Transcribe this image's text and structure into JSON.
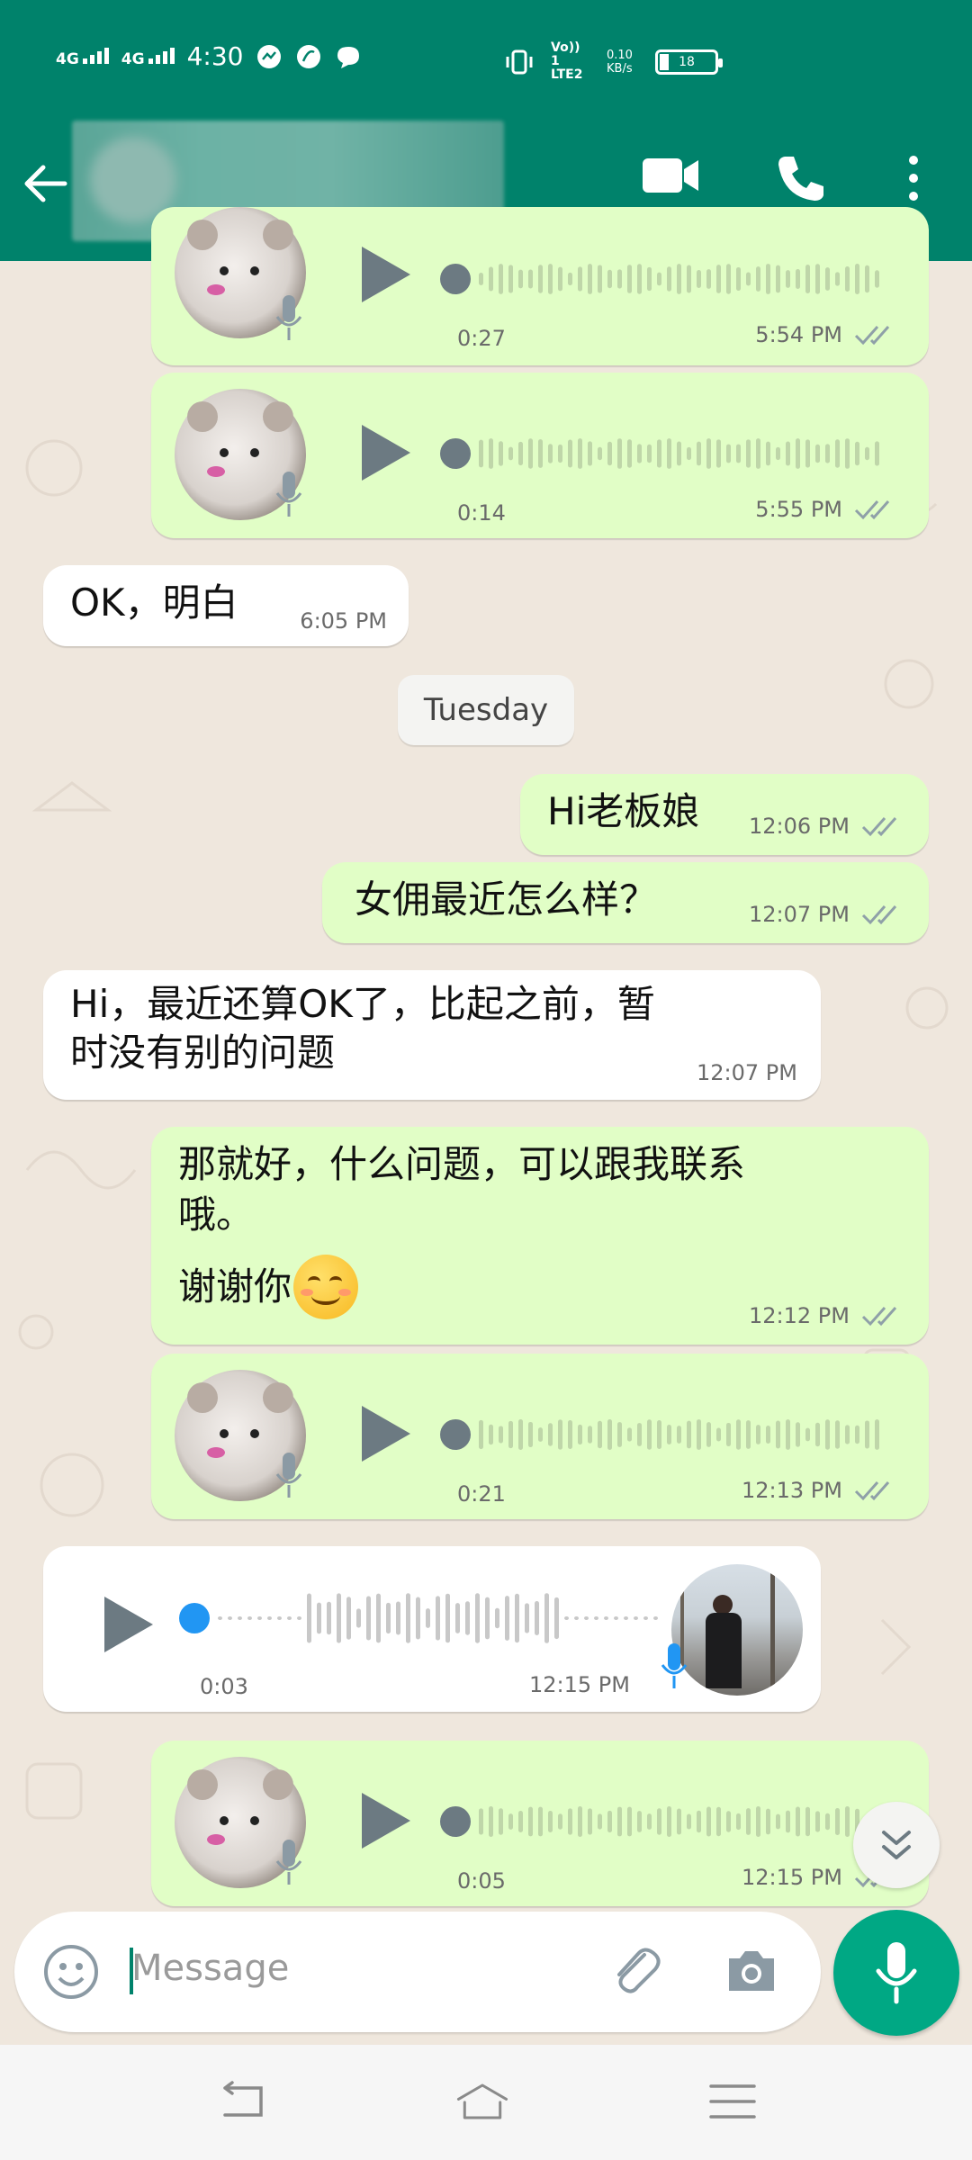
{
  "status_bar": {
    "network_1": "4G",
    "network_2": "4G",
    "time": "4:30",
    "volte": "Vo)) 1 LTE2",
    "speed": "0.10 KB/s",
    "battery": "18"
  },
  "toolbar": {
    "icons": [
      "back-arrow-icon",
      "video-call-icon",
      "voice-call-icon",
      "more-options-icon"
    ]
  },
  "messages": [
    {
      "id": "m1",
      "type": "voice",
      "direction": "out",
      "duration": "0:27",
      "time": "5:54 PM"
    },
    {
      "id": "m2",
      "type": "voice",
      "direction": "out",
      "duration": "0:14",
      "time": "5:55 PM"
    },
    {
      "id": "m3",
      "type": "text",
      "direction": "in",
      "text": "OK，明白",
      "time": "6:05 PM"
    },
    {
      "id": "m4",
      "type": "text",
      "direction": "out",
      "text": "Hi老板娘",
      "time": "12:06 PM"
    },
    {
      "id": "m5",
      "type": "text",
      "direction": "out",
      "text": "女佣最近怎么样？",
      "time": "12:07 PM"
    },
    {
      "id": "m6",
      "type": "text",
      "direction": "in",
      "line1": "Hi，最近还算OK了，比起之前，暂",
      "line2": "时没有别的问题",
      "time": "12:07 PM"
    },
    {
      "id": "m7",
      "type": "text",
      "direction": "out",
      "line1": "那就好，什么问题，可以跟我联系",
      "line2": "哦。",
      "line3": "谢谢你",
      "emoji": "😊",
      "time": "12:12 PM"
    },
    {
      "id": "m8",
      "type": "voice",
      "direction": "out",
      "duration": "0:21",
      "time": "12:13 PM"
    },
    {
      "id": "m9",
      "type": "voice",
      "direction": "in",
      "duration": "0:03",
      "time": "12:15 PM"
    },
    {
      "id": "m10",
      "type": "voice",
      "direction": "out",
      "duration": "0:05",
      "time": "12:15 PM"
    }
  ],
  "date_divider": "Tuesday",
  "composer": {
    "placeholder": "Message",
    "icons": [
      "emoji-icon",
      "attach-icon",
      "camera-icon",
      "mic-icon"
    ]
  },
  "colors": {
    "header": "#00826b",
    "outgoing_bubble": "#e1fec6",
    "incoming_bubble": "#ffffff",
    "chat_background": "#efe7dd",
    "mic_fab": "#00a884",
    "read_tick": "#8fa0a8",
    "played_dot": "#2196f3"
  }
}
